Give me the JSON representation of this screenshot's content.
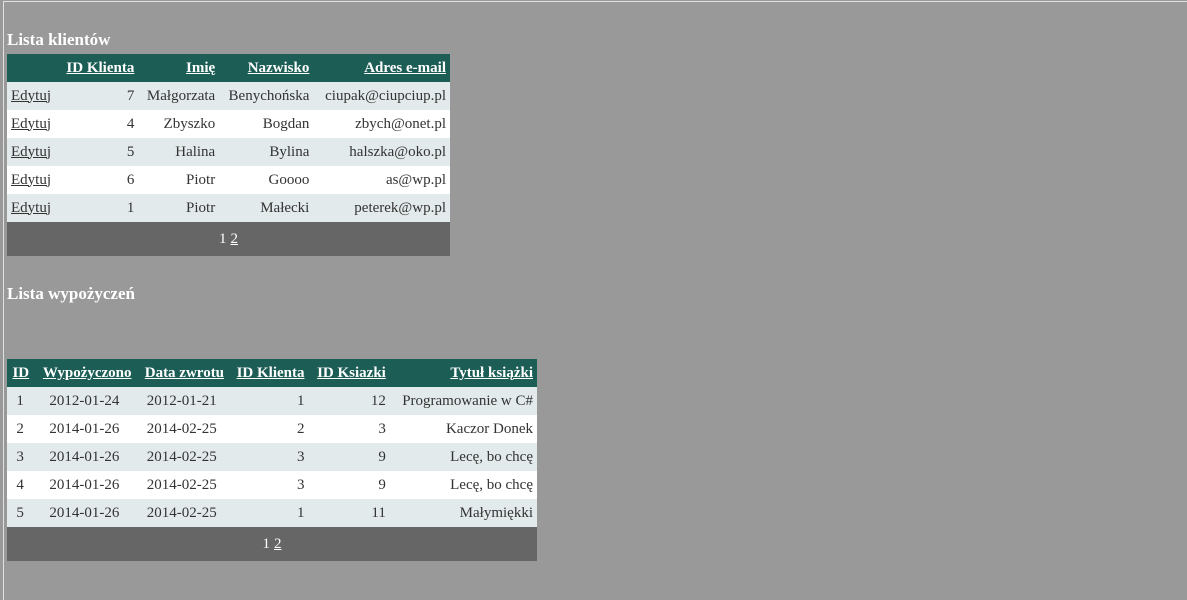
{
  "clients": {
    "title": "Lista klientów",
    "columns": [
      "",
      "ID Klienta",
      "Imię",
      "Nazwisko",
      "Adres e-mail"
    ],
    "edit_label": "Edytuj",
    "rows": [
      {
        "id": "7",
        "first": "Małgorzata",
        "last": "Benychońska",
        "email": "ciupak@ciupciup.pl"
      },
      {
        "id": "4",
        "first": "Zbyszko",
        "last": "Bogdan",
        "email": "zbych@onet.pl"
      },
      {
        "id": "5",
        "first": "Halina",
        "last": "Bylina",
        "email": "halszka@oko.pl"
      },
      {
        "id": "6",
        "first": "Piotr",
        "last": "Goooo",
        "email": "as@wp.pl"
      },
      {
        "id": "1",
        "first": "Piotr",
        "last": "Małecki",
        "email": "peterek@wp.pl"
      }
    ],
    "pager": {
      "current": "1",
      "next": "2"
    }
  },
  "rentals": {
    "title": "Lista wypożyczeń",
    "columns": [
      "ID",
      "Wypożyczono",
      "Data zwrotu",
      "ID Klienta",
      "ID Ksiazki",
      "Tytuł książki"
    ],
    "rows": [
      {
        "id": "1",
        "borrowed": "2012-01-24",
        "returned": "2012-01-21",
        "client": "1",
        "book": "12",
        "title": "Programowanie w C#"
      },
      {
        "id": "2",
        "borrowed": "2014-01-26",
        "returned": "2014-02-25",
        "client": "2",
        "book": "3",
        "title": "Kaczor Donek"
      },
      {
        "id": "3",
        "borrowed": "2014-01-26",
        "returned": "2014-02-25",
        "client": "3",
        "book": "9",
        "title": "Lecę, bo chcę"
      },
      {
        "id": "4",
        "borrowed": "2014-01-26",
        "returned": "2014-02-25",
        "client": "3",
        "book": "9",
        "title": "Lecę, bo chcę"
      },
      {
        "id": "5",
        "borrowed": "2014-01-26",
        "returned": "2014-02-25",
        "client": "1",
        "book": "11",
        "title": "Małymiękki"
      }
    ],
    "pager": {
      "current": "1",
      "next": "2"
    }
  }
}
